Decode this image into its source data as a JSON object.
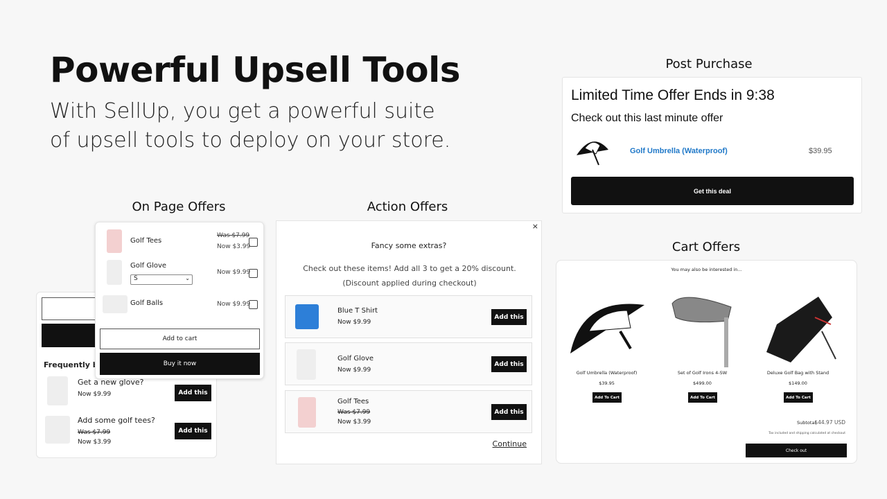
{
  "hero": {
    "title": "Powerful Upsell Tools",
    "subtitle_line1": "With SellUp, you get a powerful suite",
    "subtitle_line2": "of upsell tools to deploy on your store."
  },
  "post_purchase": {
    "label": "Post Purchase",
    "timer_text": "Limited Time Offer Ends in 9:38",
    "subheading": "Check out this last minute offer",
    "product": "Golf Umbrella (Waterproof)",
    "price": "$39.95",
    "button": "Get this deal",
    "link_color": "#1f78c8"
  },
  "on_page": {
    "label": "On Page Offers",
    "popup": {
      "items": [
        {
          "name": "Golf Tees",
          "was": "Was $7.99",
          "now": "Now $3.99"
        },
        {
          "name": "Golf Glove",
          "now": "Now $9.99",
          "select": "S"
        },
        {
          "name": "Golf Balls",
          "now": "Now $9.99"
        }
      ],
      "add_to_cart": "Add to cart",
      "buy_now": "Buy it now"
    },
    "fbt": {
      "heading": "Frequently bou",
      "items": [
        {
          "name": "Get a new glove?",
          "now": "Now $9.99",
          "button": "Add this"
        },
        {
          "name": "Add some golf tees?",
          "was": "Was $7.99",
          "now": "Now $3.99",
          "button": "Add this"
        }
      ]
    }
  },
  "action": {
    "label": "Action Offers",
    "close": "×",
    "heading": "Fancy some extras?",
    "description": "Check out these items! Add all 3 to get a 20% discount. (Discount applied during checkout)",
    "items": [
      {
        "name": "Blue T Shirt",
        "now": "Now $9.99",
        "button": "Add this"
      },
      {
        "name": "Golf Glove",
        "now": "Now $9.99",
        "button": "Add this"
      },
      {
        "name": "Golf Tees",
        "was": "Was $7.99",
        "now": "Now $3.99",
        "button": "Add this"
      }
    ],
    "continue": "Continue"
  },
  "cart": {
    "label": "Cart Offers",
    "heading": "You may also be interested in...",
    "items": [
      {
        "name": "Golf Umbrella (Waterproof)",
        "price": "$39.95",
        "button": "Add To Cart"
      },
      {
        "name": "Set of Golf Irons 4-SW",
        "price": "$499.00",
        "button": "Add To Cart"
      },
      {
        "name": "Deluxe Golf Bag with Stand",
        "price": "$149.00",
        "button": "Add To Cart"
      }
    ],
    "subtotal_label": "Subtotal",
    "subtotal": "$44.97 USD",
    "tax_note": "Tax included and shipping calculated at checkout",
    "checkout": "Check out"
  }
}
